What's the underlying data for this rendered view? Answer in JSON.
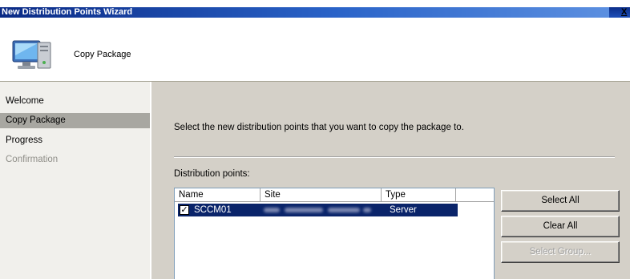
{
  "window": {
    "title": "New Distribution Points Wizard",
    "close_glyph": "X"
  },
  "header": {
    "title": "Copy Package",
    "icon": "computer-icon"
  },
  "nav": {
    "items": [
      {
        "label": "Welcome",
        "state": "normal"
      },
      {
        "label": "Copy Package",
        "state": "selected"
      },
      {
        "label": "Progress",
        "state": "normal"
      },
      {
        "label": "Confirmation",
        "state": "disabled"
      }
    ]
  },
  "main": {
    "instruction": "Select the new distribution points that you want to copy the package to.",
    "list_label": "Distribution points:",
    "columns": [
      "Name",
      "Site",
      "Type"
    ],
    "rows": [
      {
        "checked": true,
        "name": "SCCM01",
        "site": "",
        "type": "Server"
      }
    ]
  },
  "buttons": {
    "select_all": "Select All",
    "clear_all": "Clear All",
    "select_group": "Select Group..."
  },
  "colors": {
    "title_bar": "#0a2a85",
    "selection": "#0a246a",
    "panel": "#d4d0c8",
    "nav_selected": "#a8a7a1"
  }
}
